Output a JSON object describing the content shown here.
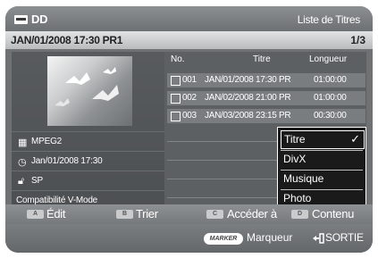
{
  "header": {
    "device_label": "DD",
    "device_icon": "hdd-icon",
    "screen_title": "Liste de Titres"
  },
  "status": {
    "datetime": "JAN/01/2008 17:30 PR1",
    "page": "1/3"
  },
  "details": {
    "format": "MPEG2",
    "recorded": "Jan/01/2008 17:30",
    "quality": "SP",
    "compatibility": "Compatibilité V-Mode"
  },
  "list": {
    "columns": {
      "no": "No.",
      "title": "Titre",
      "length": "Longueur"
    },
    "rows": [
      {
        "no": "001",
        "title": "JAN/01/2008 17:30 PR",
        "length": "01:00:00"
      },
      {
        "no": "002",
        "title": "JAN/02/2008 21:00 PR",
        "length": "01:00:00"
      },
      {
        "no": "003",
        "title": "JAN/03/2008 23:15 PR",
        "length": "00:30:00"
      }
    ]
  },
  "dropdown": {
    "items": [
      "Titre",
      "DivX",
      "Musique",
      "Photo"
    ],
    "selected": "Titre",
    "check": "✓"
  },
  "buttons": {
    "a": {
      "key": "A",
      "label": "Édit"
    },
    "b": {
      "key": "B",
      "label": "Trier"
    },
    "c": {
      "key": "C",
      "label": "Accéder à"
    },
    "d": {
      "key": "D",
      "label": "Contenu"
    }
  },
  "footer": {
    "marker_key": "MARKER",
    "marker_label": "Marqueur",
    "exit_label": "SORTIE"
  },
  "colors": {
    "background": "#6f7173",
    "key_a": "#c9cbcd",
    "dropdown_bg": "#1a1a1a"
  }
}
